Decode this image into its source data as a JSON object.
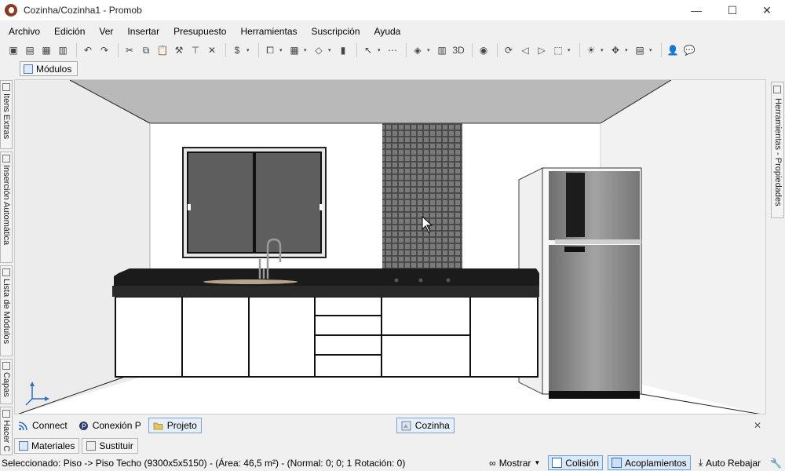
{
  "window": {
    "title": "Cozinha/Cozinha1 - Promob",
    "minimize": "—",
    "maximize": "☐",
    "close": "✕"
  },
  "menu": [
    "Archivo",
    "Edición",
    "Ver",
    "Insertar",
    "Presupuesto",
    "Herramientas",
    "Suscripción",
    "Ayuda"
  ],
  "toolbar": {
    "icons": [
      {
        "name": "save-icon",
        "glyph": "▣"
      },
      {
        "name": "print-icon",
        "glyph": "▤"
      },
      {
        "name": "render-icon",
        "glyph": "▦"
      },
      {
        "name": "printer-icon",
        "glyph": "▥"
      },
      {
        "name": "undo-icon",
        "glyph": "↶"
      },
      {
        "name": "redo-icon",
        "glyph": "↷"
      },
      {
        "name": "cut-icon",
        "glyph": "✂"
      },
      {
        "name": "copy-icon",
        "glyph": "⧉"
      },
      {
        "name": "paste-icon",
        "glyph": "📋"
      },
      {
        "name": "hammer-icon",
        "glyph": "⚒"
      },
      {
        "name": "tool-icon",
        "glyph": "⊤"
      },
      {
        "name": "delete-icon",
        "glyph": "✕"
      },
      {
        "name": "budget-icon",
        "glyph": "$"
      },
      {
        "name": "group-icon",
        "glyph": "⧠"
      },
      {
        "name": "wall-icon",
        "glyph": "▦"
      },
      {
        "name": "shape-icon",
        "glyph": "◇"
      },
      {
        "name": "material-icon",
        "glyph": "▮"
      },
      {
        "name": "pointer-icon",
        "glyph": "↖"
      },
      {
        "name": "measure-icon",
        "glyph": "⋯"
      },
      {
        "name": "layers-icon",
        "glyph": "◈"
      },
      {
        "name": "view2d-icon",
        "glyph": "▥"
      },
      {
        "name": "view3d-icon",
        "glyph": "3D"
      },
      {
        "name": "eye-icon",
        "glyph": "◉"
      },
      {
        "name": "rotate-icon",
        "glyph": "⟳"
      },
      {
        "name": "move-left-icon",
        "glyph": "◁"
      },
      {
        "name": "move-right-icon",
        "glyph": "▷"
      },
      {
        "name": "camera-icon",
        "glyph": "⬚"
      },
      {
        "name": "light-icon",
        "glyph": "☀"
      },
      {
        "name": "move-icon",
        "glyph": "✥"
      },
      {
        "name": "align-icon",
        "glyph": "▤"
      },
      {
        "name": "user-icon",
        "glyph": "👤"
      },
      {
        "name": "chat-icon",
        "glyph": "💬"
      }
    ]
  },
  "modules_tab": "Módulos",
  "left_tabs": [
    "Itens Extras",
    "Inserción Automática",
    "Lista de Módulos",
    "Capas",
    "Hacer C"
  ],
  "right_tab": "Herramientas - Propiedades",
  "bottom_tabs": {
    "connect": "Connect",
    "conexion": "Conexión P",
    "projeto": "Projeto",
    "cozinha": "Cozinha",
    "close": "✕"
  },
  "bottom_tabs2": [
    "Materiales",
    "Sustituir"
  ],
  "status": {
    "selected": "Seleccionado: Piso -> Piso Techo (9300x5x5150) - (Área: 46,5 m²) - (Normal: 0; 0; 1 Rotación: 0)",
    "mostrar": "Mostrar",
    "colision": "Colisión",
    "acoplamientos": "Acoplamientos",
    "auto_rebajar": "Auto Rebajar"
  },
  "colors": {
    "accent": "#2f6fbf",
    "granite": "#1b1b1b",
    "fridge": "#8c8c8c"
  }
}
